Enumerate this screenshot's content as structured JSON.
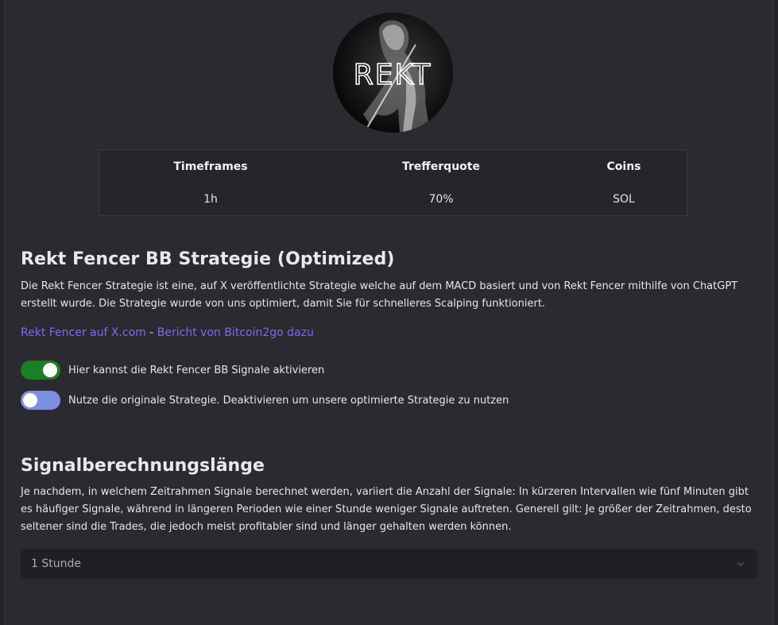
{
  "logo": {
    "text": "REKT"
  },
  "stats": {
    "columns": [
      {
        "label": "Timeframes",
        "value": "1h"
      },
      {
        "label": "Trefferquote",
        "value": "70%"
      },
      {
        "label": "Coins",
        "value": "SOL"
      }
    ]
  },
  "strategy": {
    "title": "Rekt Fencer BB Strategie (Optimized)",
    "description": "Die Rekt Fencer Strategie ist eine, auf X veröffentlichte Strategie welche auf dem MACD basiert und von Rekt Fencer mithilfe von ChatGPT erstellt wurde. Die Strategie wurde von uns optimiert, damit Sie für schnelleres Scalping funktioniert.",
    "link_x": "Rekt Fencer auf X.com",
    "link_separator": " - ",
    "link_report": "Bericht von Bitcoin2go dazu",
    "toggles": [
      {
        "label": "Hier kannst die Rekt Fencer BB Signale aktivieren",
        "on": true
      },
      {
        "label": "Nutze die originale Strategie. Deaktivieren um unsere optimierte Strategie zu nutzen",
        "on": false
      }
    ]
  },
  "signal": {
    "title": "Signalberechnungslänge",
    "description": "Je nachdem, in welchem Zeitrahmen Signale berechnet werden, variiert die Anzahl der Signale: In kürzeren Intervallen wie fünf Minuten gibt es häufiger Signale, während in längeren Perioden wie einer Stunde weniger Signale auftreten. Generell gilt: Je größer der Zeitrahmen, desto seltener sind die Trades, die jedoch meist profitabler sind und länger gehalten werden können.",
    "select_value": "1 Stunde",
    "select_icon": "chevron-down-icon"
  },
  "colors": {
    "background": "#2a2a30",
    "link": "#7c6cf0",
    "toggle_on": "#1b7f24",
    "toggle_off": "#7d8de0"
  }
}
